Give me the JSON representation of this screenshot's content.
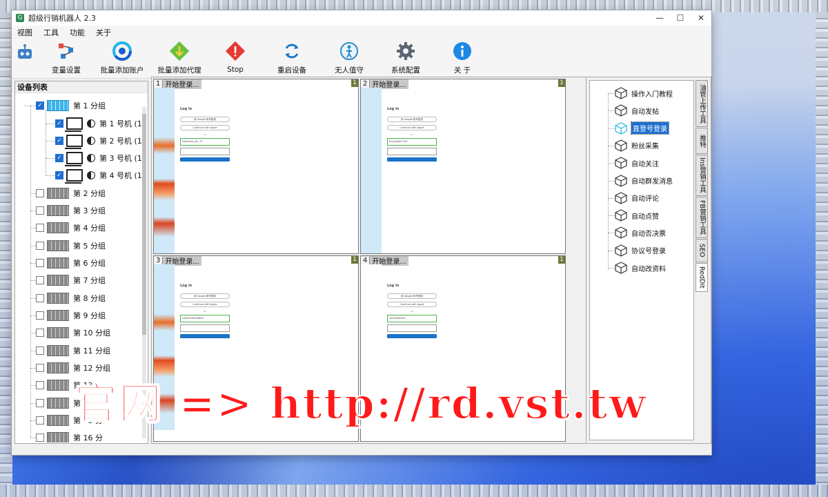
{
  "window": {
    "title": "超级行销机器人 2.3",
    "app_icon": "G"
  },
  "window_controls": {
    "minimize": "—",
    "maximize": "☐",
    "close": "✕"
  },
  "menu": [
    "视图",
    "工具",
    "功能",
    "关于"
  ],
  "toolbar": [
    {
      "label": "变量设置",
      "icon": "variable-icon"
    },
    {
      "label": "批量添加账户",
      "icon": "add-account-icon"
    },
    {
      "label": "批量添加代理",
      "icon": "add-proxy-icon"
    },
    {
      "label": "Stop",
      "icon": "stop-icon"
    },
    {
      "label": "重启设备",
      "icon": "restart-icon"
    },
    {
      "label": "无人值守",
      "icon": "unattended-icon"
    },
    {
      "label": "系统配置",
      "icon": "gear-icon"
    },
    {
      "label": "关 于",
      "icon": "info-icon"
    }
  ],
  "device_list": {
    "title": "设备列表",
    "groups": [
      "第 1 分组",
      "第 2 分组",
      "第 3 分组",
      "第 4 分组",
      "第 5 分组",
      "第 6 分组",
      "第 7 分组",
      "第 8 分组",
      "第 9 分组",
      "第 10 分组",
      "第 11 分组",
      "第 12 分组",
      "第 13",
      "第 14",
      "第 15 分",
      "第 16 分"
    ],
    "devices": [
      "第 1 号机 (1)",
      "第 2 号机 (1)",
      "第 3 号机 (1)",
      "第 4 号机 (1)"
    ]
  },
  "screens": [
    {
      "num": "1",
      "label": "开始登录...",
      "badge": "1",
      "field": "Discovery_BL_73"
    },
    {
      "num": "2",
      "label": "开始登录...",
      "badge": "1",
      "field": "EmployRef 023"
    },
    {
      "num": "3",
      "label": "开始登录...",
      "badge": "1",
      "field": "Lenora.k6h4a8ZZ"
    },
    {
      "num": "4",
      "label": "开始登录...",
      "badge": "1",
      "field": "shuhadDreria"
    }
  ],
  "login_form": {
    "heading": "Log in",
    "google": "用 Google 帐号登录",
    "apple": "Continue with Apple",
    "or": "OR"
  },
  "right_tree": {
    "items": [
      "操作入门教程",
      "自动发帖",
      "直登号登录",
      "粉丝采集",
      "自动关注",
      "自动群发消息",
      "自动评论",
      "自动点赞",
      "自动否决票",
      "协议号登录",
      "自动改资料"
    ],
    "selected_index": 2
  },
  "side_tabs": [
    "油管上传工具",
    "推特",
    "Ins营销工具",
    "FB营销工具",
    "SEO",
    "RedDit"
  ],
  "side_tab_active": 5,
  "overlay": {
    "text": "官网 => http://rd.vst.tw"
  },
  "colors": {
    "accent": "#1f6fd1",
    "overlay": "#ff1a1a"
  }
}
